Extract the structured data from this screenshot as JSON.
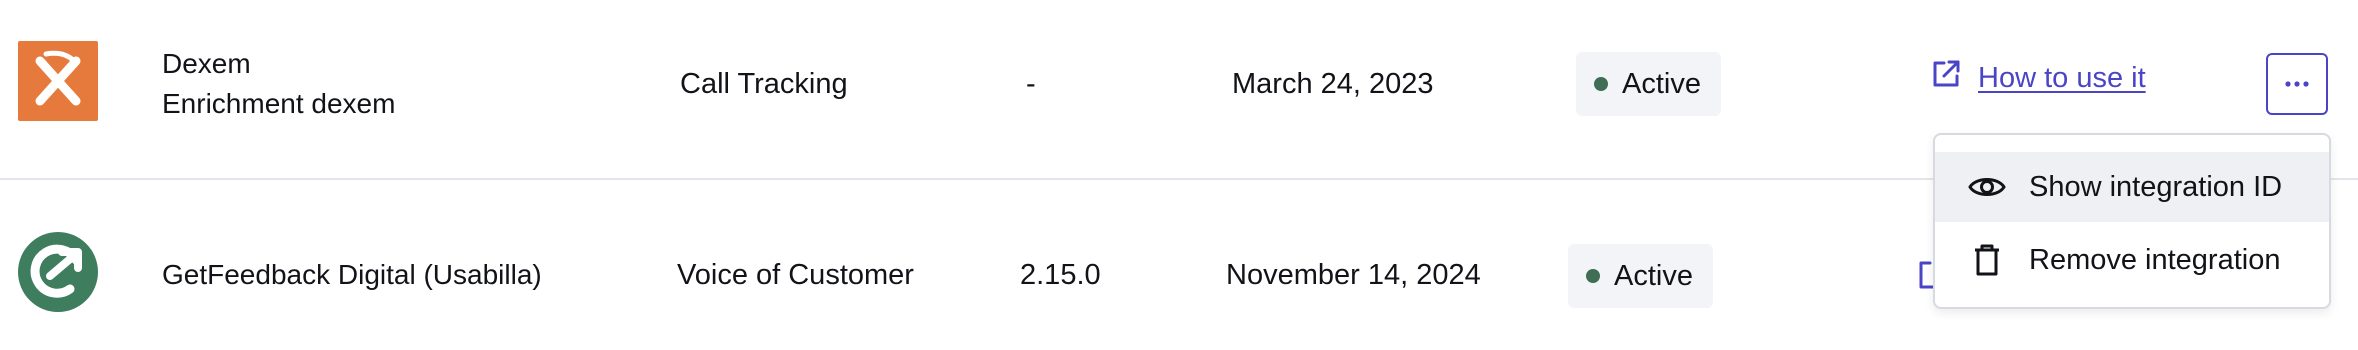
{
  "rows": [
    {
      "logo_icon": "dexem-logo",
      "name_line1": "Dexem",
      "name_line2": "Enrichment dexem",
      "category": "Call Tracking",
      "version": "-",
      "date": "March 24, 2023",
      "status": "Active",
      "link_label": "How to use it"
    },
    {
      "logo_icon": "getfeedback-logo",
      "name": "GetFeedback Digital (Usabilla)",
      "category": "Voice of Customer",
      "version": "2.15.0",
      "date": "November 14, 2024",
      "status": "Active"
    }
  ],
  "menu": {
    "items": [
      {
        "label": "Show integration ID",
        "icon": "eye-icon"
      },
      {
        "label": "Remove integration",
        "icon": "trash-icon"
      }
    ]
  },
  "colors": {
    "accent": "#4a45c6",
    "status_dot": "#3f6e55",
    "dexem_brand": "#e67a3c",
    "getfeedback_brand": "#3f7d5f"
  }
}
